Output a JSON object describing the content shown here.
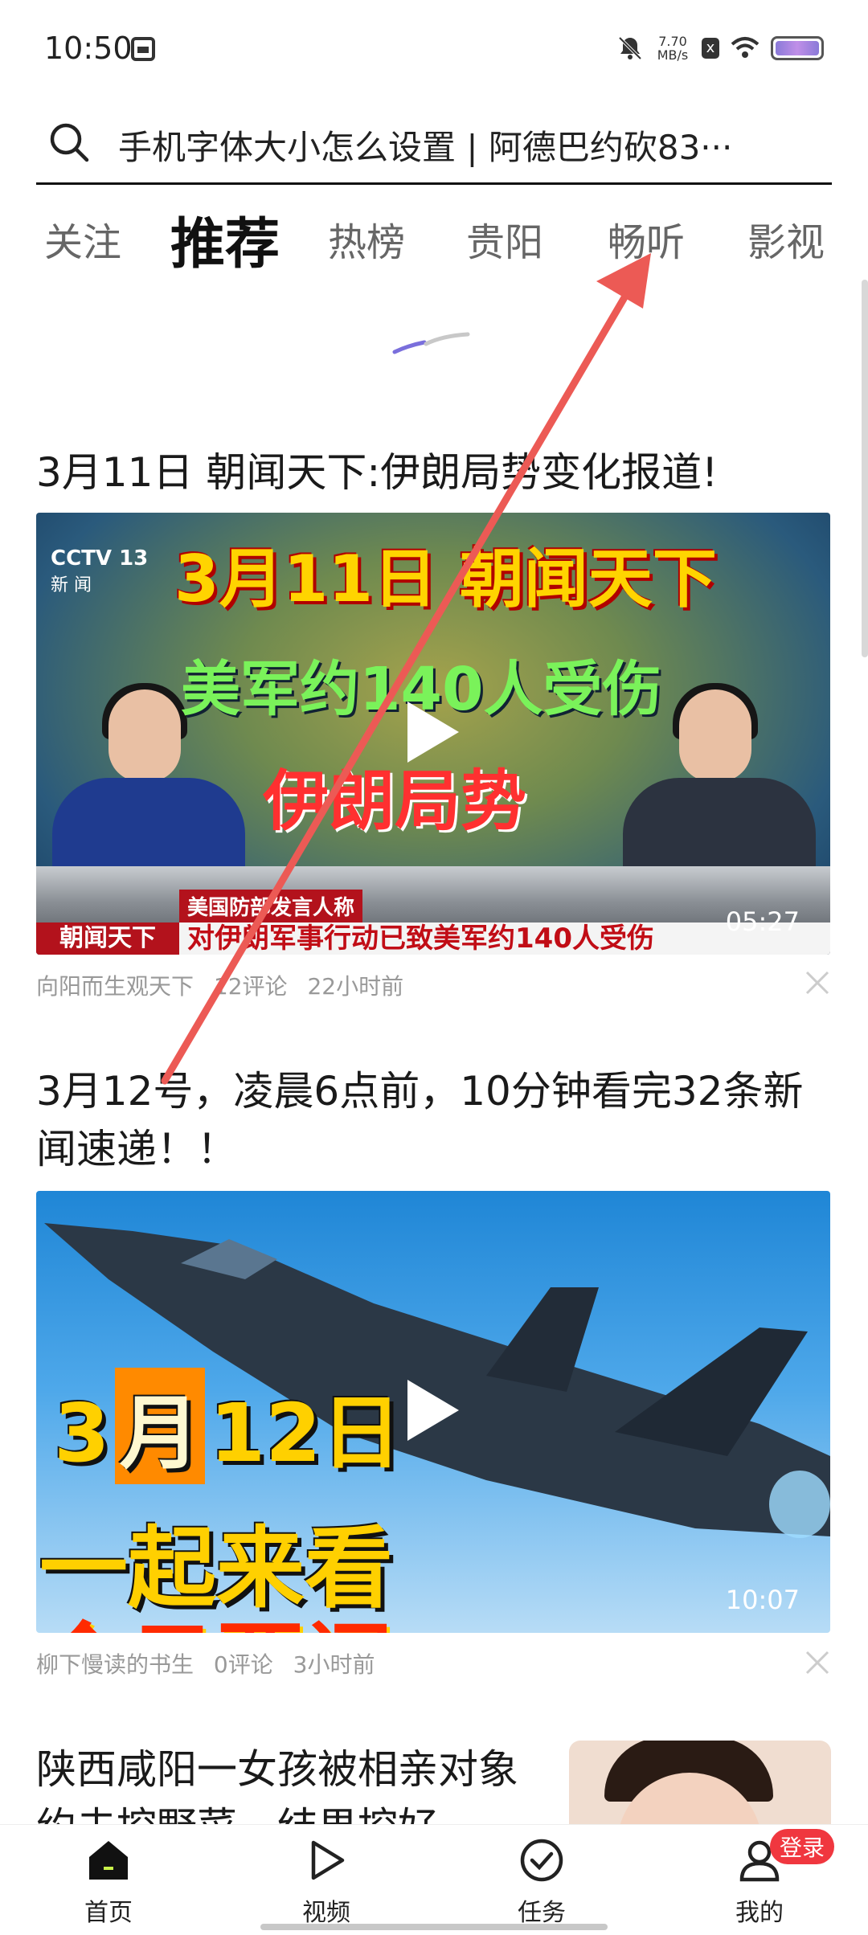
{
  "status_bar": {
    "time": "10:50",
    "net_speed_value": "7.70",
    "net_speed_unit": "MB/s",
    "notification_badge": "x"
  },
  "search": {
    "query": "手机字体大小怎么设置 | 阿德巴约砍83···"
  },
  "tabs": [
    {
      "label": "关注"
    },
    {
      "label": "推荐",
      "active": true
    },
    {
      "label": "热榜"
    },
    {
      "label": "贵阳"
    },
    {
      "label": "畅听"
    },
    {
      "label": "影视"
    }
  ],
  "feed": [
    {
      "title": "3月11日 朝闻天下:伊朗局势变化报道!",
      "thumb": {
        "channel": "CCTV 13",
        "channel_sub": "新 闻",
        "line1": "3月11日 朝闻天下",
        "line2": "美军约140人受伤",
        "line3": "伊朗局势",
        "banner_top": "美国防部发言人称",
        "banner_left": "朝闻天下",
        "banner_main": "对伊朗军事行动已致美军约140人受伤"
      },
      "duration": "05:27",
      "author": "向阳而生观天下",
      "comments": "12评论",
      "time": "22小时前"
    },
    {
      "title": "3月12号，凌晨6点前，10分钟看完32条新闻速递！！",
      "thumb": {
        "day_prefix": "3",
        "month": "月",
        "day": "12日",
        "line2": "一起来看",
        "line3": "今日要闻"
      },
      "duration": "10:07",
      "author": "柳下慢读的书生",
      "comments": "0评论",
      "time": "3小时前"
    },
    {
      "title": "陕西咸阳一女孩被相亲对象约去挖野菜，结果挖好"
    }
  ],
  "bottom_nav": [
    {
      "label": "首页",
      "icon": "home-icon",
      "active": true
    },
    {
      "label": "视频",
      "icon": "play-icon"
    },
    {
      "label": "任务",
      "icon": "check-circle-icon"
    },
    {
      "label": "我的",
      "icon": "user-icon"
    }
  ],
  "login_badge": "登录",
  "colors": {
    "accent_red": "#f0373f",
    "arrow": "#ec5a55",
    "loader_purple": "#7a6fdc"
  }
}
